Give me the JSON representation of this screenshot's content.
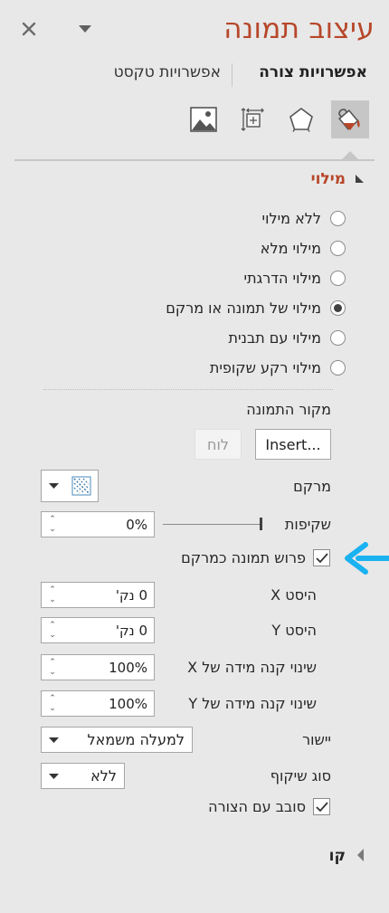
{
  "header": {
    "title": "עיצוב תמונה",
    "close_glyph": "✕",
    "menu_glyph": "▼"
  },
  "tabs": [
    {
      "label": "אפשרויות צורה",
      "active": true
    },
    {
      "label": "אפשרויות טקסט",
      "active": false
    }
  ],
  "icons": {
    "selected": "fill-line-icon",
    "items": [
      "fill-line-icon",
      "effects-icon",
      "size-properties-icon",
      "picture-icon"
    ],
    "accent": "#b7472a"
  },
  "fill_section": {
    "title": "מילוי",
    "options": [
      {
        "label": "ללא מילוי",
        "ul": "ל",
        "checked": false
      },
      {
        "label": "מילוי מלא",
        "ul": "מ",
        "checked": false
      },
      {
        "label": "מילוי הדרגתי",
        "ul": "ד",
        "checked": false
      },
      {
        "label": "מילוי של תמונה או מרקם",
        "ul": "ת",
        "checked": true
      },
      {
        "label": "מילוי עם תבנית",
        "ul": "ב",
        "checked": false
      },
      {
        "label": "מילוי רקע שקופית",
        "ul": "ר",
        "checked": false
      }
    ]
  },
  "picture_source": {
    "label": "מקור התמונה",
    "insert_button": "Insert...",
    "clipboard_button": "לוח"
  },
  "texture": {
    "label": "מרקם"
  },
  "transparency": {
    "label": "שקיפות",
    "value": "0%",
    "level": 0
  },
  "tile": {
    "label": "פרוש תמונה כמרקם",
    "checked": true
  },
  "offset_x": {
    "label": "היסט X",
    "value": "0 נק'"
  },
  "offset_y": {
    "label": "היסט Y",
    "value": "0 נק'"
  },
  "scale_x": {
    "label": "שינוי קנה מידה של X",
    "value": "100%"
  },
  "scale_y": {
    "label": "שינוי קנה מידה של Y",
    "value": "100%"
  },
  "alignment": {
    "label": "יישור",
    "value": "למעלה משמאל"
  },
  "mirror_type": {
    "label": "סוג שיקוף",
    "value": "ללא"
  },
  "rotate_with_shape": {
    "label": "סובב עם הצורה",
    "checked": true
  },
  "line_section": {
    "title": "קו"
  },
  "annotation_arrow_color": "#1ab2f0"
}
